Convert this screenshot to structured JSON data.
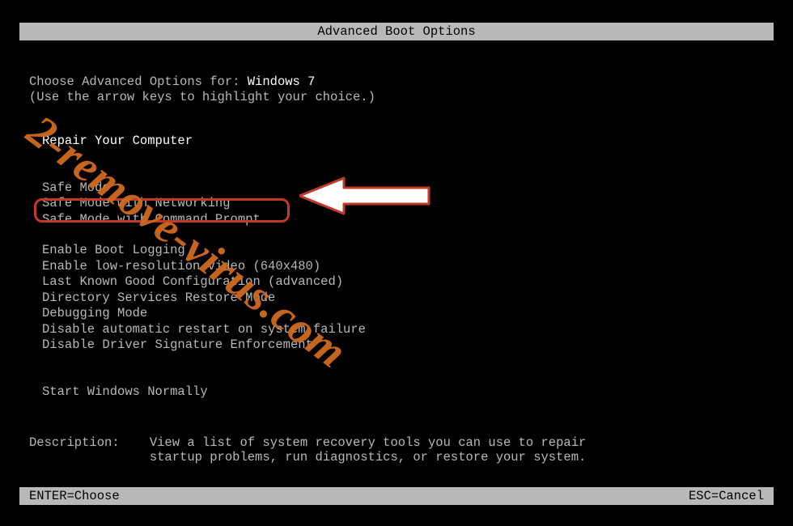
{
  "title": "Advanced Boot Options",
  "choose_prefix": "Choose Advanced Options for: ",
  "os_name": "Windows 7",
  "hint": "(Use the arrow keys to highlight your choice.)",
  "menu": {
    "group1": [
      "Repair Your Computer"
    ],
    "group2": [
      "Safe Mode",
      "Safe Mode with Networking",
      "Safe Mode with Command Prompt"
    ],
    "group3": [
      "Enable Boot Logging",
      "Enable low-resolution video (640x480)",
      "Last Known Good Configuration (advanced)",
      "Directory Services Restore Mode",
      "Debugging Mode",
      "Disable automatic restart on system failure",
      "Disable Driver Signature Enforcement"
    ],
    "group4": [
      "Start Windows Normally"
    ]
  },
  "description": {
    "label": "Description:    ",
    "text": "View a list of system recovery tools you can use to repair\nstartup problems, run diagnostics, or restore your system."
  },
  "footer": {
    "left": "ENTER=Choose",
    "right": "ESC=Cancel"
  },
  "watermark": "2-remove-virus.com"
}
